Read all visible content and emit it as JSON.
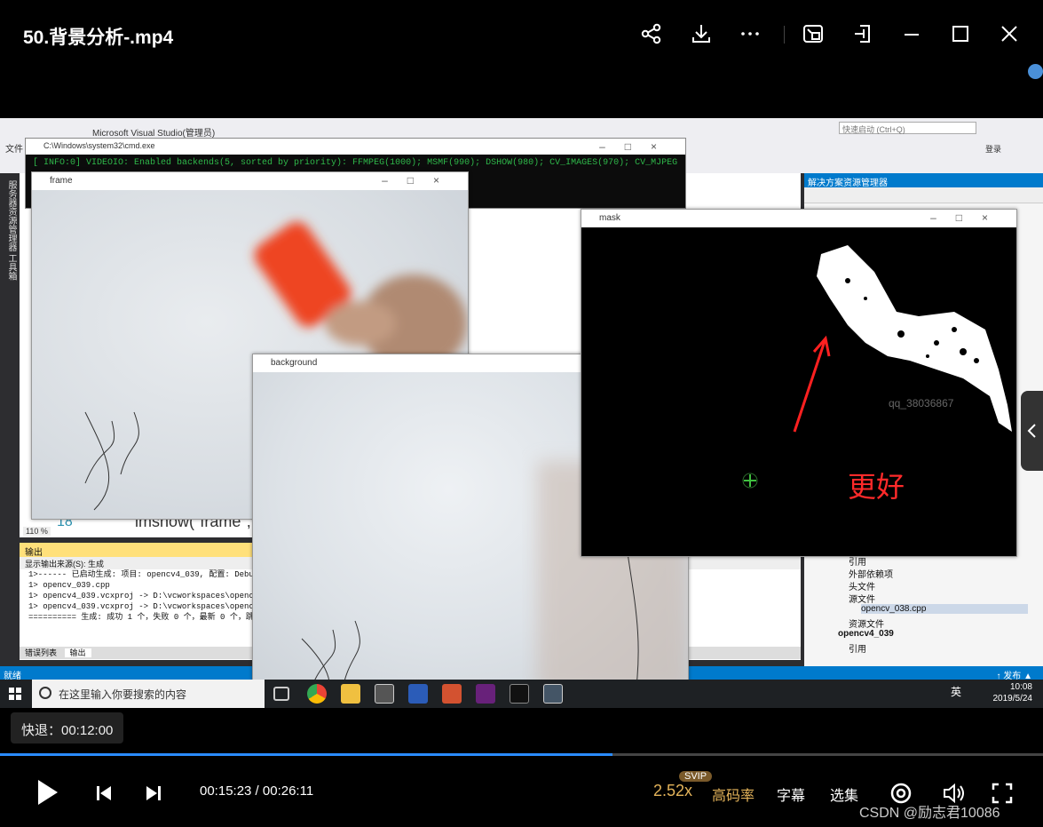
{
  "player": {
    "title": "50.背景分析-.mp4",
    "tooltip": "快退：00:12:00",
    "time": "00:15:23 / 00:26:11",
    "progress": 0.587,
    "speed": "2.52x",
    "speed_badge": "SVIP",
    "quality": "高码率",
    "subtitle": "字幕",
    "episodes": "选集",
    "watermark": "CSDN @励志君10086"
  },
  "video_content": {
    "vs_title": "Microsoft Visual Studio(管理员)",
    "quick_launch": "快速启动 (Ctrl+Q)",
    "login": "登录",
    "file_menu": "文件",
    "left_toolbar_text": "服务器资源管理器  工具箱",
    "cmd_title": "C:\\Windows\\system32\\cmd.exe",
    "cmd_text": "[ INFO:0] VIDEOIO: Enabled backends(5, sorted by priority): FFMPEG(1000); MSMF(990); DSHOW(980); CV_IMAGES(970); CV_MJPEG",
    "frame_title": "frame",
    "background_title": "background",
    "mask_title": "mask",
    "mask_watermark": "qq_38036867",
    "annotation": "更好",
    "code_line_no": "18",
    "code_text": "imshow(\"frame\", f",
    "zoom": "110 %",
    "solution_title": "解决方案资源管理器",
    "tree": [
      "引用",
      "外部依赖项",
      "头文件",
      "源文件",
      "opencv_038.cpp",
      "资源文件",
      "opencv4_039",
      "引用"
    ],
    "output_title": "输出",
    "output_source_label": "显示输出来源(S):",
    "output_source_value": "生成",
    "output_lines": [
      "1>------ 已启动生成: 项目: opencv4_039, 配置: Debug",
      "1>  opencv_039.cpp",
      "1>  opencv4_039.vcxproj -> D:\\vcworkspaces\\opencv4_",
      "1>  opencv4_039.vcxproj -> D:\\vcworkspaces\\opencv4",
      "========== 生成: 成功 1 个，失败 0 个，最新 0 个，跳"
    ],
    "tab_errors": "错误列表",
    "tab_output": "输出",
    "status_ready": "就绪",
    "status_publish": "↑ 发布 ▲",
    "taskbar_search": "在这里输入你要搜索的内容",
    "tray_lang": "英",
    "tray_time": "10:08",
    "tray_date": "2019/5/24"
  }
}
